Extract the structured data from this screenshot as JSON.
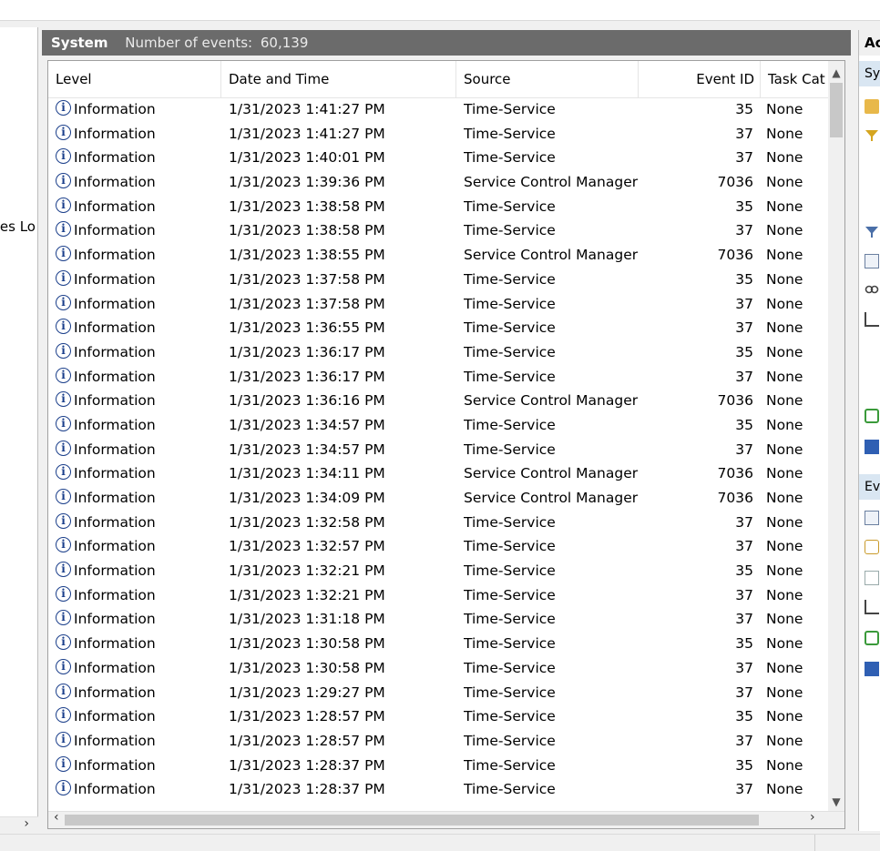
{
  "tree": {
    "partial_label": "es Lo"
  },
  "header": {
    "title": "System",
    "count_label": "Number of events:",
    "count_value": "60,139"
  },
  "columns": [
    "Level",
    "Date and Time",
    "Source",
    "Event ID",
    "Task Cat"
  ],
  "rows": [
    {
      "level": "Information",
      "date": "1/31/2023 1:41:27 PM",
      "source": "Time-Service",
      "event_id": "35",
      "task": "None"
    },
    {
      "level": "Information",
      "date": "1/31/2023 1:41:27 PM",
      "source": "Time-Service",
      "event_id": "37",
      "task": "None"
    },
    {
      "level": "Information",
      "date": "1/31/2023 1:40:01 PM",
      "source": "Time-Service",
      "event_id": "37",
      "task": "None"
    },
    {
      "level": "Information",
      "date": "1/31/2023 1:39:36 PM",
      "source": "Service Control Manager",
      "event_id": "7036",
      "task": "None"
    },
    {
      "level": "Information",
      "date": "1/31/2023 1:38:58 PM",
      "source": "Time-Service",
      "event_id": "35",
      "task": "None"
    },
    {
      "level": "Information",
      "date": "1/31/2023 1:38:58 PM",
      "source": "Time-Service",
      "event_id": "37",
      "task": "None"
    },
    {
      "level": "Information",
      "date": "1/31/2023 1:38:55 PM",
      "source": "Service Control Manager",
      "event_id": "7036",
      "task": "None"
    },
    {
      "level": "Information",
      "date": "1/31/2023 1:37:58 PM",
      "source": "Time-Service",
      "event_id": "35",
      "task": "None"
    },
    {
      "level": "Information",
      "date": "1/31/2023 1:37:58 PM",
      "source": "Time-Service",
      "event_id": "37",
      "task": "None"
    },
    {
      "level": "Information",
      "date": "1/31/2023 1:36:55 PM",
      "source": "Time-Service",
      "event_id": "37",
      "task": "None"
    },
    {
      "level": "Information",
      "date": "1/31/2023 1:36:17 PM",
      "source": "Time-Service",
      "event_id": "35",
      "task": "None"
    },
    {
      "level": "Information",
      "date": "1/31/2023 1:36:17 PM",
      "source": "Time-Service",
      "event_id": "37",
      "task": "None"
    },
    {
      "level": "Information",
      "date": "1/31/2023 1:36:16 PM",
      "source": "Service Control Manager",
      "event_id": "7036",
      "task": "None"
    },
    {
      "level": "Information",
      "date": "1/31/2023 1:34:57 PM",
      "source": "Time-Service",
      "event_id": "35",
      "task": "None"
    },
    {
      "level": "Information",
      "date": "1/31/2023 1:34:57 PM",
      "source": "Time-Service",
      "event_id": "37",
      "task": "None"
    },
    {
      "level": "Information",
      "date": "1/31/2023 1:34:11 PM",
      "source": "Service Control Manager",
      "event_id": "7036",
      "task": "None"
    },
    {
      "level": "Information",
      "date": "1/31/2023 1:34:09 PM",
      "source": "Service Control Manager",
      "event_id": "7036",
      "task": "None"
    },
    {
      "level": "Information",
      "date": "1/31/2023 1:32:58 PM",
      "source": "Time-Service",
      "event_id": "37",
      "task": "None"
    },
    {
      "level": "Information",
      "date": "1/31/2023 1:32:57 PM",
      "source": "Time-Service",
      "event_id": "37",
      "task": "None"
    },
    {
      "level": "Information",
      "date": "1/31/2023 1:32:21 PM",
      "source": "Time-Service",
      "event_id": "35",
      "task": "None"
    },
    {
      "level": "Information",
      "date": "1/31/2023 1:32:21 PM",
      "source": "Time-Service",
      "event_id": "37",
      "task": "None"
    },
    {
      "level": "Information",
      "date": "1/31/2023 1:31:18 PM",
      "source": "Time-Service",
      "event_id": "37",
      "task": "None"
    },
    {
      "level": "Information",
      "date": "1/31/2023 1:30:58 PM",
      "source": "Time-Service",
      "event_id": "35",
      "task": "None"
    },
    {
      "level": "Information",
      "date": "1/31/2023 1:30:58 PM",
      "source": "Time-Service",
      "event_id": "37",
      "task": "None"
    },
    {
      "level": "Information",
      "date": "1/31/2023 1:29:27 PM",
      "source": "Time-Service",
      "event_id": "37",
      "task": "None"
    },
    {
      "level": "Information",
      "date": "1/31/2023 1:28:57 PM",
      "source": "Time-Service",
      "event_id": "35",
      "task": "None"
    },
    {
      "level": "Information",
      "date": "1/31/2023 1:28:57 PM",
      "source": "Time-Service",
      "event_id": "37",
      "task": "None"
    },
    {
      "level": "Information",
      "date": "1/31/2023 1:28:37 PM",
      "source": "Time-Service",
      "event_id": "35",
      "task": "None"
    },
    {
      "level": "Information",
      "date": "1/31/2023 1:28:37 PM",
      "source": "Time-Service",
      "event_id": "37",
      "task": "None"
    }
  ],
  "actions": {
    "header": "Ac",
    "section_system": "Sy",
    "section_event": "Ev"
  },
  "icons": {
    "level": "info-icon",
    "scroll_up": "chevron-up-icon",
    "scroll_down": "chevron-down-icon",
    "scroll_left": "chevron-left-icon",
    "scroll_right": "chevron-right-icon"
  },
  "colors": {
    "header_bg": "#6b6b6b",
    "info_icon": "#1a3e8a",
    "action_section_bg": "#d9e6f2"
  }
}
